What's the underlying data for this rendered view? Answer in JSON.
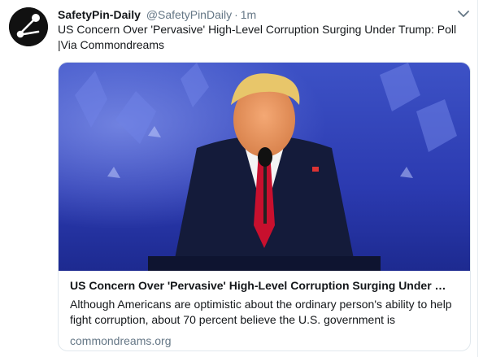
{
  "tweet": {
    "display_name": "SafetyPin-Daily",
    "handle": "@SafetyPinDaily",
    "separator": "·",
    "time": "1m",
    "text_line1": "US Concern Over 'Pervasive' High-Level Corruption Surging Under Trump: Poll",
    "text_line2": "|Via Commondreams"
  },
  "card": {
    "title": "US Concern Over 'Pervasive' High-Level Corruption Surging Under Tr...",
    "description": "Although Americans are optimistic about the ordinary person's ability to help fight corruption, about 70 percent believe the U.S. government is",
    "domain": "commondreams.org"
  },
  "icons": {
    "avatar": "safety-pin-logo",
    "caret": "chevron-down-icon"
  },
  "colors": {
    "text": "#14171a",
    "secondary": "#657786",
    "border": "#e1e8ed"
  }
}
